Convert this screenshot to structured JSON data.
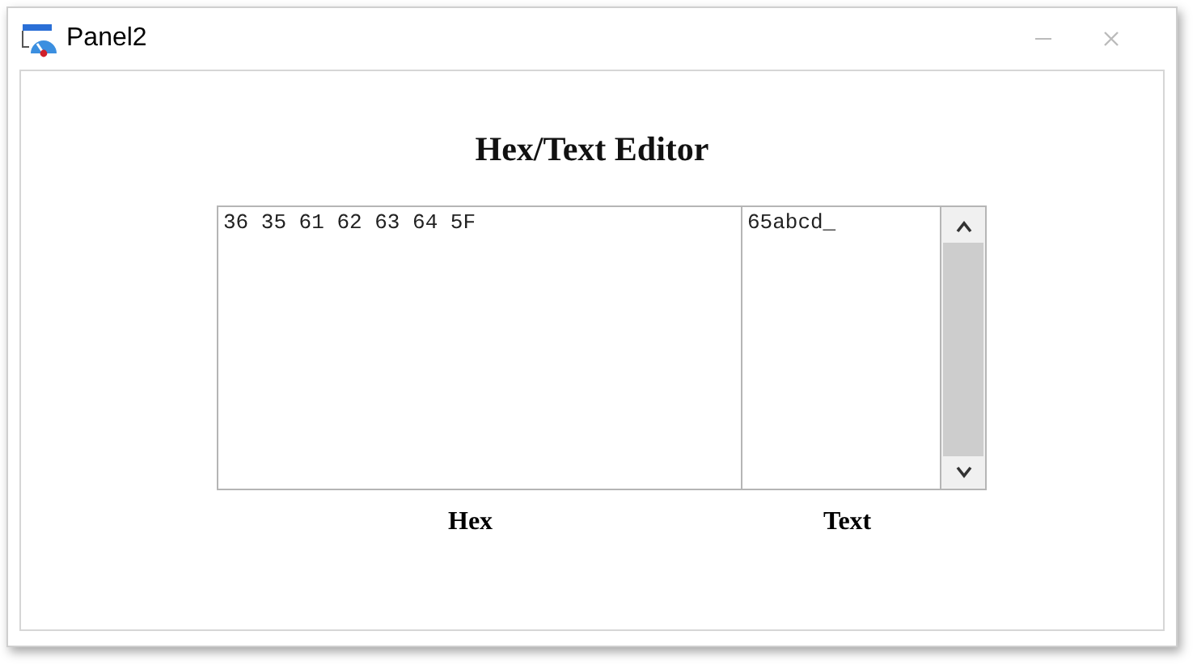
{
  "window": {
    "title": "Panel2"
  },
  "heading": "Hex/Text Editor",
  "hex_field": {
    "value": "36 35 61 62 63 64 5F",
    "label": "Hex"
  },
  "text_field": {
    "value": "65abcd_",
    "label": "Text"
  }
}
